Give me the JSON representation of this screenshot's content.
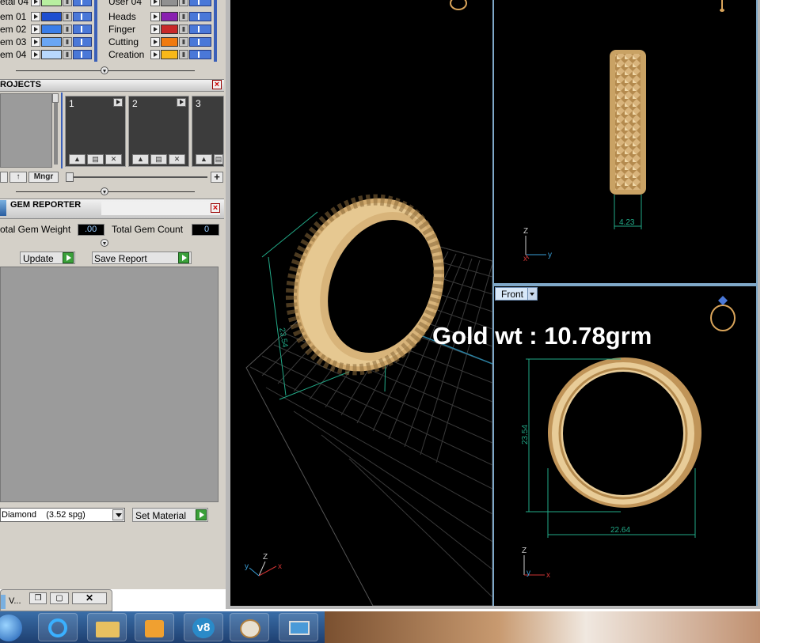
{
  "layers": {
    "left_rows": [
      {
        "label": "etal 04",
        "color": "#b8f0a0"
      },
      {
        "label": "em 01",
        "color": "#1e4fd0"
      },
      {
        "label": "em 02",
        "color": "#3a7ee8"
      },
      {
        "label": "em 03",
        "color": "#6aa6f4"
      },
      {
        "label": "em 04",
        "color": "#b8d8fc"
      }
    ],
    "right_rows": [
      {
        "label": "User 04",
        "color": "#909090"
      },
      {
        "label": "Heads",
        "color": "#8a20b0"
      },
      {
        "label": "Finger",
        "color": "#c82828"
      },
      {
        "label": "Cutting",
        "color": "#f07a10"
      },
      {
        "label": "Creation",
        "color": "#f8b818"
      }
    ]
  },
  "projects": {
    "title": "ROJECTS",
    "slots": [
      "1",
      "2",
      "3"
    ],
    "mngr_label": "Mngr",
    "add_label": "+"
  },
  "gem_reporter": {
    "title": "GEM REPORTER",
    "total_weight_label": "otal Gem Weight",
    "total_weight_value": ".00",
    "total_count_label": "Total Gem Count",
    "total_count_value": "0",
    "update_label": "Update",
    "save_report_label": "Save Report",
    "material_value": "Diamond    (3.52 spg)",
    "set_material_label": "Set Material"
  },
  "mini_window": {
    "label": "V..."
  },
  "viewports": {
    "front_label": "Front",
    "gold_weight_text": "Gold wt : 10.78grm",
    "side_dim": "4.23",
    "front_height_dim": "23.54",
    "front_width_dim": "22.64",
    "persp_dim": "23.54",
    "axis_z": "Z",
    "axis_y": "y",
    "axis_x": "x"
  },
  "taskbar": {
    "icons": [
      "start-orb-icon",
      "internet-explorer-icon",
      "file-explorer-icon",
      "media-player-icon",
      "v8-app-icon",
      "paint-icon",
      "photo-viewer-icon"
    ],
    "v8_label": "v8"
  },
  "colors": {
    "panel_bg": "#d4d0c8",
    "viewport_bg": "#000000",
    "dim_green": "#22aa88",
    "gold": "#d9b47c"
  }
}
